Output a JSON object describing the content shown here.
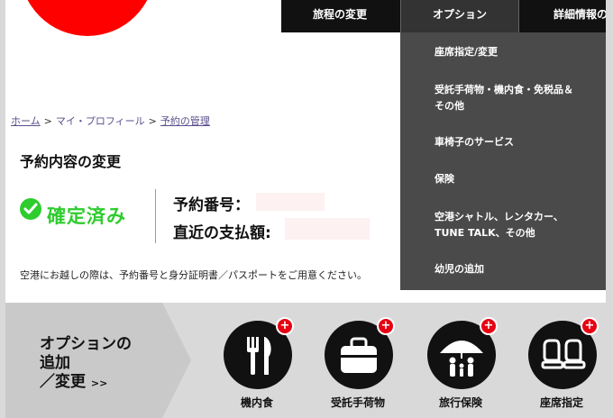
{
  "nav": {
    "travel_change": "旅程の変更",
    "options": "オプション",
    "details": "詳細情報の"
  },
  "dropdown": {
    "items": [
      {
        "label": "座席指定/変更"
      },
      {
        "label": "受託手荷物・機内食・免税品＆\nその他"
      },
      {
        "label": "車椅子のサービス"
      },
      {
        "label": "保険"
      },
      {
        "label": "空港シャトル、レンタカー、\nTUNE TALK、その他"
      },
      {
        "label": "幼児の追加"
      }
    ]
  },
  "breadcrumb": {
    "home": "ホーム",
    "profile": "マイ・プロフィール",
    "manage": "予約の管理",
    "sep": ">"
  },
  "page_title": "予約内容の変更",
  "status": {
    "text": "確定済み",
    "color": "#2ecc2e"
  },
  "booking": {
    "number_label": "予約番号：",
    "payment_label": "直近の支払額:"
  },
  "notice": "空港にお越しの際は、予約番号と身分証明書／パスポートをご用意ください。",
  "options_banner": {
    "heading_line1": "オプションの",
    "heading_line2": "追加",
    "heading_line3": "／変更",
    "more": ">>",
    "items": [
      {
        "label": "機内食",
        "icon": "fork-knife-icon"
      },
      {
        "label": "受託手荷物",
        "icon": "luggage-icon"
      },
      {
        "label": "旅行保険",
        "icon": "umbrella-family-icon"
      },
      {
        "label": "座席指定",
        "icon": "seat-icon"
      }
    ],
    "plus": "+"
  },
  "colors": {
    "brand": "#ff0000",
    "nav_bg": "#111111",
    "dropdown_bg": "#4a4a4a",
    "plus_badge": "#e60012"
  }
}
